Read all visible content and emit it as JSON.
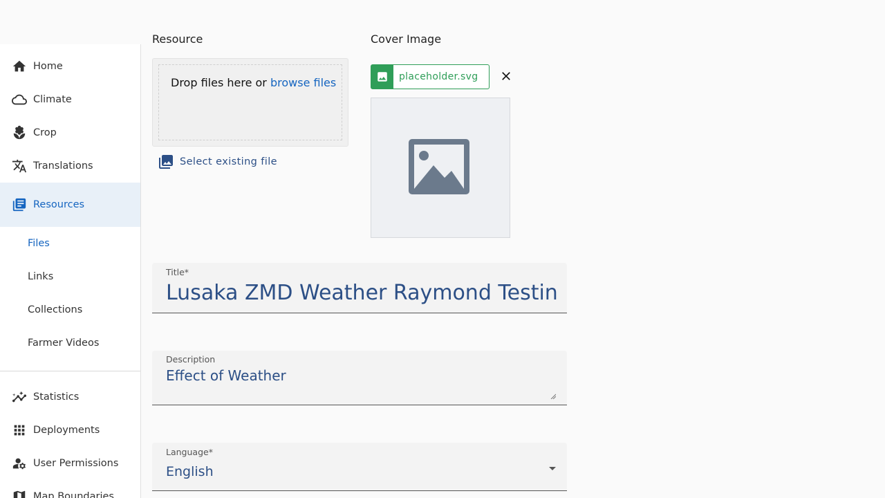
{
  "sidebar": {
    "items": [
      {
        "label": "Home",
        "icon": "home-icon"
      },
      {
        "label": "Climate",
        "icon": "cloud-icon"
      },
      {
        "label": "Crop",
        "icon": "sprout-icon"
      },
      {
        "label": "Translations",
        "icon": "translate-icon"
      },
      {
        "label": "Resources",
        "icon": "library-icon",
        "active": true
      }
    ],
    "sub_items": [
      {
        "label": "Files",
        "active": true
      },
      {
        "label": "Links"
      },
      {
        "label": "Collections"
      },
      {
        "label": "Farmer Videos"
      }
    ],
    "bottom_items": [
      {
        "label": "Statistics",
        "icon": "chart-line-icon"
      },
      {
        "label": "Deployments",
        "icon": "grid-icon"
      },
      {
        "label": "User Permissions",
        "icon": "user-cog-icon"
      },
      {
        "label": "Map Boundaries",
        "icon": "map-icon"
      }
    ]
  },
  "resource": {
    "label": "Resource",
    "drop_text": "Drop files here or ",
    "browse_link": "browse files",
    "select_existing": "Select existing file"
  },
  "cover": {
    "label": "Cover Image",
    "file_name": "placeholder.svg"
  },
  "form": {
    "title_label": "Title*",
    "title_value": "Lusaka ZMD Weather Raymond Testing",
    "description_label": "Description",
    "description_value": "Effect of Weather",
    "language_label": "Language*",
    "language_value": "English"
  },
  "colors": {
    "accent": "#1565c0",
    "success": "#2f9e58",
    "value_text": "#2c4f86"
  }
}
